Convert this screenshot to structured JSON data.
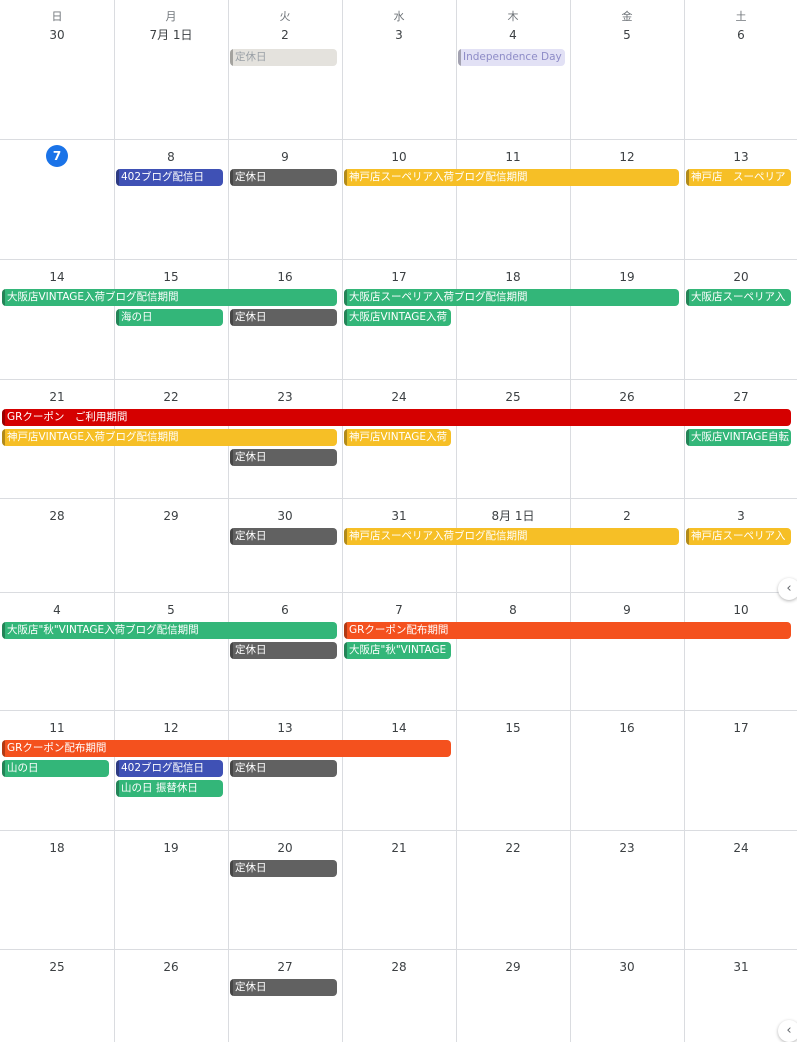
{
  "weekdays": [
    "日",
    "月",
    "火",
    "水",
    "木",
    "金",
    "土"
  ],
  "today": "7",
  "weeks": [
    [
      "30",
      "7月 1日",
      "2",
      "3",
      "4",
      "5",
      "6"
    ],
    [
      "7",
      "8",
      "9",
      "10",
      "11",
      "12",
      "13"
    ],
    [
      "14",
      "15",
      "16",
      "17",
      "18",
      "19",
      "20"
    ],
    [
      "21",
      "22",
      "23",
      "24",
      "25",
      "26",
      "27"
    ],
    [
      "28",
      "29",
      "30",
      "31",
      "8月 1日",
      "2",
      "3"
    ],
    [
      "4",
      "5",
      "6",
      "7",
      "8",
      "9",
      "10"
    ],
    [
      "11",
      "12",
      "13",
      "14",
      "15",
      "16",
      "17"
    ],
    [
      "18",
      "19",
      "20",
      "21",
      "22",
      "23",
      "24"
    ],
    [
      "25",
      "26",
      "27",
      "28",
      "29",
      "30",
      "31"
    ]
  ],
  "colors": {
    "gray_light": "#e4e2dd",
    "lavender": "#e2e1f5",
    "blue": "#3f51b5",
    "dark": "#616161",
    "yellow": "#f6bf26",
    "green": "#33b679",
    "red": "#d50000",
    "orange": "#f4511e",
    "today": "#1a73e8"
  },
  "events": [
    {
      "week": 0,
      "col": 2,
      "span": 1,
      "lane": 0,
      "title": "定休日",
      "color": "gray_light",
      "style": "light"
    },
    {
      "week": 0,
      "col": 4,
      "span": 1,
      "lane": 0,
      "title": "Independence Day",
      "color": "lavender",
      "style": "lav"
    },
    {
      "week": 1,
      "col": 1,
      "span": 1,
      "lane": 0,
      "title": "402ブログ配信日",
      "color": "blue"
    },
    {
      "week": 1,
      "col": 2,
      "span": 1,
      "lane": 0,
      "title": "定休日",
      "color": "dark"
    },
    {
      "week": 1,
      "col": 3,
      "span": 3,
      "lane": 0,
      "title": "神戸店スーペリア入荷ブログ配信期間",
      "color": "yellow"
    },
    {
      "week": 1,
      "col": 6,
      "span": 1,
      "lane": 0,
      "title": "神戸店　スーペリア",
      "color": "yellow"
    },
    {
      "week": 2,
      "col": 0,
      "span": 3,
      "lane": 0,
      "title": "大阪店VINTAGE入荷ブログ配信期間",
      "color": "green"
    },
    {
      "week": 2,
      "col": 3,
      "span": 3,
      "lane": 0,
      "title": "大阪店スーペリア入荷ブログ配信期間",
      "color": "green"
    },
    {
      "week": 2,
      "col": 6,
      "span": 1,
      "lane": 0,
      "title": "大阪店スーペリア入",
      "color": "green"
    },
    {
      "week": 2,
      "col": 1,
      "span": 1,
      "lane": 1,
      "title": "海の日",
      "color": "green"
    },
    {
      "week": 2,
      "col": 2,
      "span": 1,
      "lane": 1,
      "title": "定休日",
      "color": "dark"
    },
    {
      "week": 2,
      "col": 3,
      "span": 1,
      "lane": 1,
      "title": "大阪店VINTAGE入荷",
      "color": "green"
    },
    {
      "week": 3,
      "col": 0,
      "span": 7,
      "lane": 0,
      "title": "GRクーポン　ご利用期間",
      "color": "red"
    },
    {
      "week": 3,
      "col": 0,
      "span": 3,
      "lane": 1,
      "title": "神戸店VINTAGE入荷ブログ配信期間",
      "color": "yellow"
    },
    {
      "week": 3,
      "col": 3,
      "span": 1,
      "lane": 1,
      "title": "神戸店VINTAGE入荷",
      "color": "yellow"
    },
    {
      "week": 3,
      "col": 6,
      "span": 1,
      "lane": 1,
      "title": "大阪店VINTAGE自転",
      "color": "green"
    },
    {
      "week": 3,
      "col": 2,
      "span": 1,
      "lane": 2,
      "title": "定休日",
      "color": "dark"
    },
    {
      "week": 4,
      "col": 2,
      "span": 1,
      "lane": 0,
      "title": "定休日",
      "color": "dark"
    },
    {
      "week": 4,
      "col": 3,
      "span": 3,
      "lane": 0,
      "title": "神戸店スーペリア入荷ブログ配信期間",
      "color": "yellow"
    },
    {
      "week": 4,
      "col": 6,
      "span": 1,
      "lane": 0,
      "title": "神戸店スーペリア入",
      "color": "yellow"
    },
    {
      "week": 5,
      "col": 0,
      "span": 3,
      "lane": 0,
      "title": "大阪店\"秋\"VINTAGE入荷ブログ配信期間",
      "color": "green"
    },
    {
      "week": 5,
      "col": 3,
      "span": 4,
      "lane": 0,
      "title": "GRクーポン配布期間",
      "color": "orange"
    },
    {
      "week": 5,
      "col": 2,
      "span": 1,
      "lane": 1,
      "title": "定休日",
      "color": "dark"
    },
    {
      "week": 5,
      "col": 3,
      "span": 1,
      "lane": 1,
      "title": "大阪店\"秋\"VINTAGE",
      "color": "green"
    },
    {
      "week": 6,
      "col": 0,
      "span": 4,
      "lane": 0,
      "title": "GRクーポン配布期間",
      "color": "orange"
    },
    {
      "week": 6,
      "col": 0,
      "span": 1,
      "lane": 1,
      "title": "山の日",
      "color": "green"
    },
    {
      "week": 6,
      "col": 1,
      "span": 1,
      "lane": 1,
      "title": "402ブログ配信日",
      "color": "blue"
    },
    {
      "week": 6,
      "col": 2,
      "span": 1,
      "lane": 1,
      "title": "定休日",
      "color": "dark"
    },
    {
      "week": 6,
      "col": 1,
      "span": 1,
      "lane": 2,
      "title": "山の日 振替休日",
      "color": "green"
    },
    {
      "week": 7,
      "col": 2,
      "span": 1,
      "lane": 0,
      "title": "定休日",
      "color": "dark"
    },
    {
      "week": 8,
      "col": 2,
      "span": 1,
      "lane": 0,
      "title": "定休日",
      "color": "dark"
    }
  ],
  "scroll_icons": [
    "chevron-left-icon",
    "chevron-left-icon"
  ],
  "scroll_glyph": "‹"
}
